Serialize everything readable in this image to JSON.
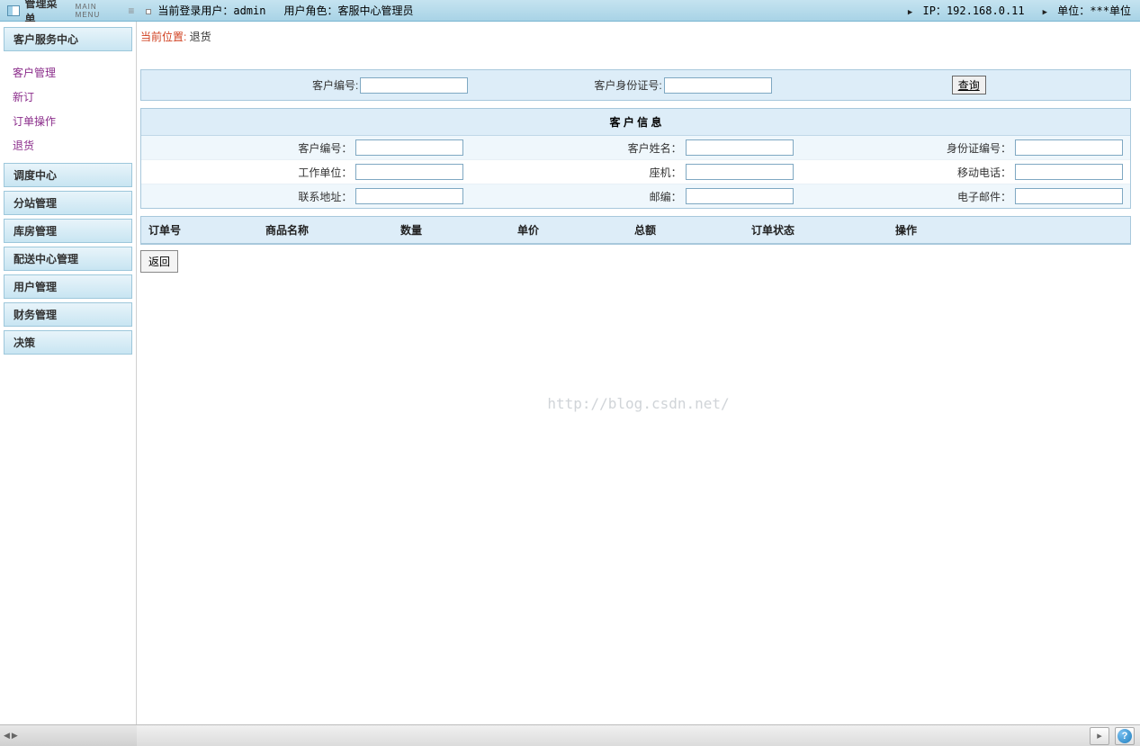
{
  "header": {
    "menu_title": "管理菜单",
    "menu_subtitle": "MAIN MENU",
    "current_user_label": "当前登录用户：",
    "current_user": "admin",
    "role_label": "用户角色：",
    "role": "客服中心管理员",
    "ip_label": "IP：",
    "ip": "192.168.0.11",
    "unit_label": "单位：",
    "unit": "***单位"
  },
  "sidebar": {
    "sections": [
      {
        "title": "客户服务中心",
        "expanded": true,
        "items": [
          "客户管理",
          "新订",
          "订单操作",
          "退货"
        ]
      },
      {
        "title": "调度中心"
      },
      {
        "title": "分站管理"
      },
      {
        "title": "库房管理"
      },
      {
        "title": "配送中心管理"
      },
      {
        "title": "用户管理"
      },
      {
        "title": "财务管理"
      },
      {
        "title": "决策"
      }
    ],
    "active_item": "退货"
  },
  "breadcrumb": {
    "label": "当前位置: ",
    "value": "退货"
  },
  "search": {
    "fields": [
      {
        "label": "客户编号:",
        "value": ""
      },
      {
        "label": "客户身份证号:",
        "value": ""
      }
    ],
    "query_btn": "查询"
  },
  "info_panel": {
    "title": "客 户 信 息",
    "rows": [
      [
        {
          "label": "客户编号：",
          "value": ""
        },
        {
          "label": "客户姓名：",
          "value": ""
        },
        {
          "label": "身份证编号：",
          "value": ""
        }
      ],
      [
        {
          "label": "工作单位：",
          "value": ""
        },
        {
          "label": "座机：",
          "value": ""
        },
        {
          "label": "移动电话：",
          "value": ""
        }
      ],
      [
        {
          "label": "联系地址：",
          "value": ""
        },
        {
          "label": "邮编：",
          "value": ""
        },
        {
          "label": "电子邮件：",
          "value": ""
        }
      ]
    ]
  },
  "table": {
    "headers": [
      "订单号",
      "商品名称",
      "数量",
      "单价",
      "总额",
      "订单状态",
      "操作"
    ]
  },
  "buttons": {
    "back": "返回"
  },
  "watermark": "http://blog.csdn.net/",
  "footer": {
    "help": "?"
  }
}
